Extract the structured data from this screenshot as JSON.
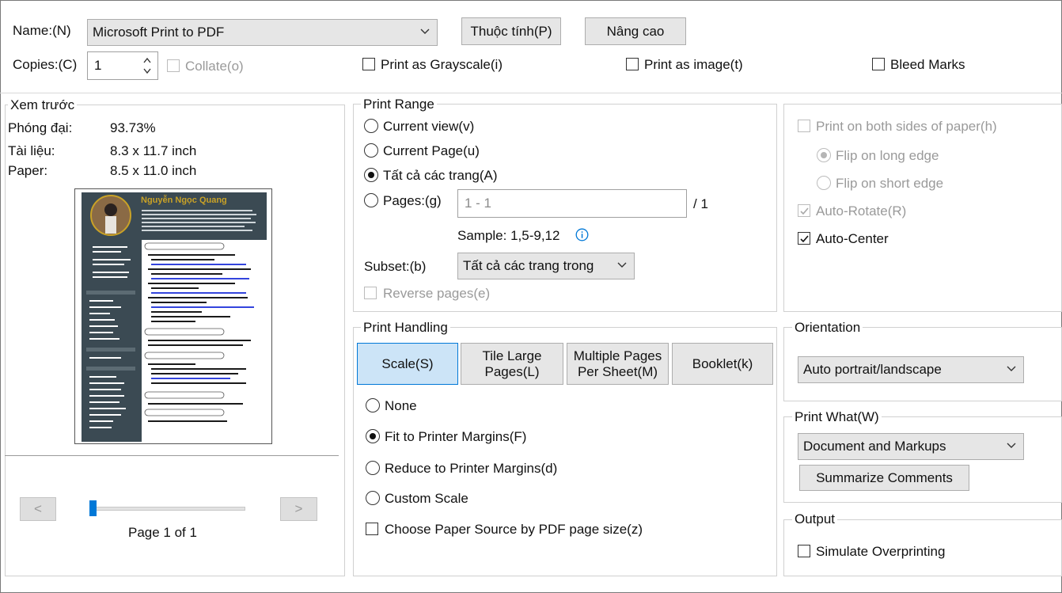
{
  "printer": {
    "name_label": "Name:(N)",
    "name_value": "Microsoft Print to PDF",
    "properties_button": "Thuộc tính(P)",
    "advanced_button": "Nâng cao",
    "copies_label": "Copies:(C)",
    "copies_value": "1",
    "collate_label": "Collate(o)",
    "grayscale_label": "Print as Grayscale(i)",
    "as_image_label": "Print as image(t)",
    "bleed_label": "Bleed Marks"
  },
  "preview": {
    "title": "Xem trước",
    "zoom_label": "Phóng đại:",
    "zoom_value": "93.73%",
    "document_label": "Tài liệu:",
    "document_value": "8.3 x 11.7 inch",
    "paper_label": "Paper:",
    "paper_value": "8.5 x 11.0 inch",
    "prev_button": "<",
    "next_button": ">",
    "page_status": "Page 1 of 1",
    "page_slider_fraction": 0.0,
    "thumb": {
      "name": "Nguyễn Ngọc Quang",
      "sections": [
        "Project",
        "EDUCATION",
        "PREVIOUS JOBS",
        "CERTIFICATIONS",
        "GITHUB"
      ],
      "left_sections": [
        "SKILL HIGHLIGHTS",
        "LANGUAGES",
        "HOBBIES"
      ]
    }
  },
  "print_range": {
    "title": "Print Range",
    "current_view": "Current view(v)",
    "current_page": "Current Page(u)",
    "all_pages": "Tất cả các trang(A)",
    "pages_label": "Pages:(g)",
    "pages_value": "1 - 1",
    "pages_total": "/ 1",
    "sample": "Sample: 1,5-9,12",
    "subset_label": "Subset:(b)",
    "subset_value": "Tất cả các trang trong",
    "reverse_label": "Reverse pages(e)",
    "selected": "all_pages"
  },
  "duplex": {
    "both_sides": "Print on both sides of paper(h)",
    "flip_long": "Flip on long edge",
    "flip_short": "Flip on short edge",
    "auto_rotate": "Auto-Rotate(R)",
    "auto_center": "Auto-Center"
  },
  "print_handling": {
    "title": "Print Handling",
    "tabs": [
      "Scale(S)",
      "Tile Large Pages(L)",
      "Multiple Pages Per Sheet(M)",
      "Booklet(k)"
    ],
    "selected_tab": "Scale(S)",
    "none": "None",
    "fit": "Fit to Printer Margins(F)",
    "reduce": "Reduce to Printer Margins(d)",
    "custom": "Custom Scale",
    "paper_source": "Choose Paper Source by PDF page size(z)",
    "selected": "fit"
  },
  "orientation": {
    "title": "Orientation",
    "value": "Auto portrait/landscape"
  },
  "print_what": {
    "title": "Print What(W)",
    "value": "Document and Markups",
    "summarize_button": "Summarize Comments"
  },
  "output": {
    "title": "Output",
    "simulate_label": "Simulate Overprinting"
  },
  "colors": {
    "selected_tab_bg": "#cce4f7",
    "selected_tab_border": "#0078d7",
    "button_bg": "#e6e6e6",
    "thumb_sidebar": "#3b4a53",
    "thumb_name": "#c9a227",
    "slider_thumb": "#0078d7",
    "info_icon": "#0078d7"
  }
}
